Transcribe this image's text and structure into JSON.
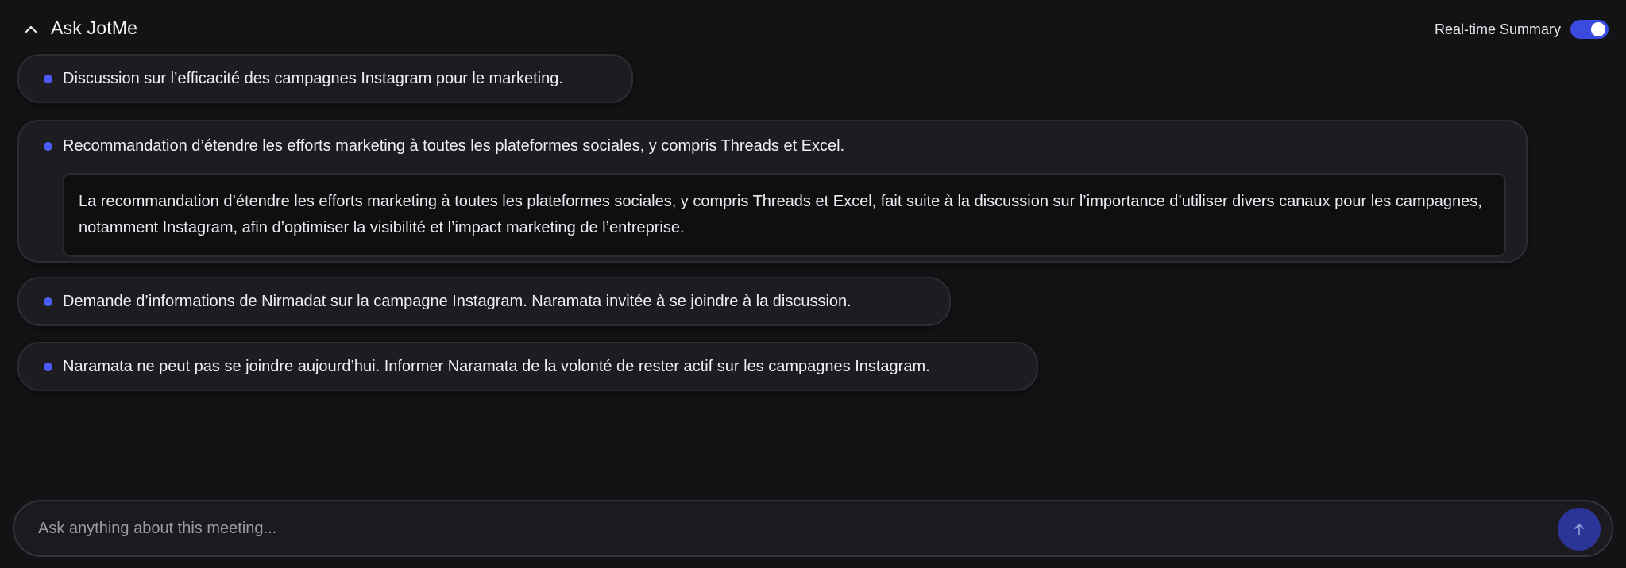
{
  "header": {
    "title": "Ask JotMe",
    "toggle_label": "Real-time Summary",
    "toggle_on": true
  },
  "summary": {
    "items": [
      {
        "text": "Discussion sur l’efficacité des campagnes Instagram pour le marketing."
      },
      {
        "text": "Recommandation d’étendre les efforts marketing à toutes les plateformes sociales, y compris Threads et Excel.",
        "detail": "La recommandation d’étendre les efforts marketing à toutes les plateformes sociales, y compris Threads et Excel, fait suite à la discussion sur l’importance d’utiliser divers canaux pour les campagnes, notamment Instagram, afin d’optimiser la visibilité et l’impact marketing de l’entreprise."
      },
      {
        "text": "Demande d’informations de Nirmadat sur la campagne Instagram. Naramata invitée à se joindre à la discussion."
      },
      {
        "text": "Naramata ne peut pas se joindre aujourd’hui. Informer Naramata de la volonté de rester actif sur les campagnes Instagram."
      }
    ]
  },
  "ask": {
    "placeholder": "Ask anything about this meeting..."
  },
  "icons": {
    "collapse": "chevron-up-icon",
    "send": "arrow-up-icon"
  },
  "colors": {
    "accent": "#3b4be0",
    "bullet": "#4a5cf5",
    "send_button": "#2b3598",
    "background": "#131316"
  }
}
